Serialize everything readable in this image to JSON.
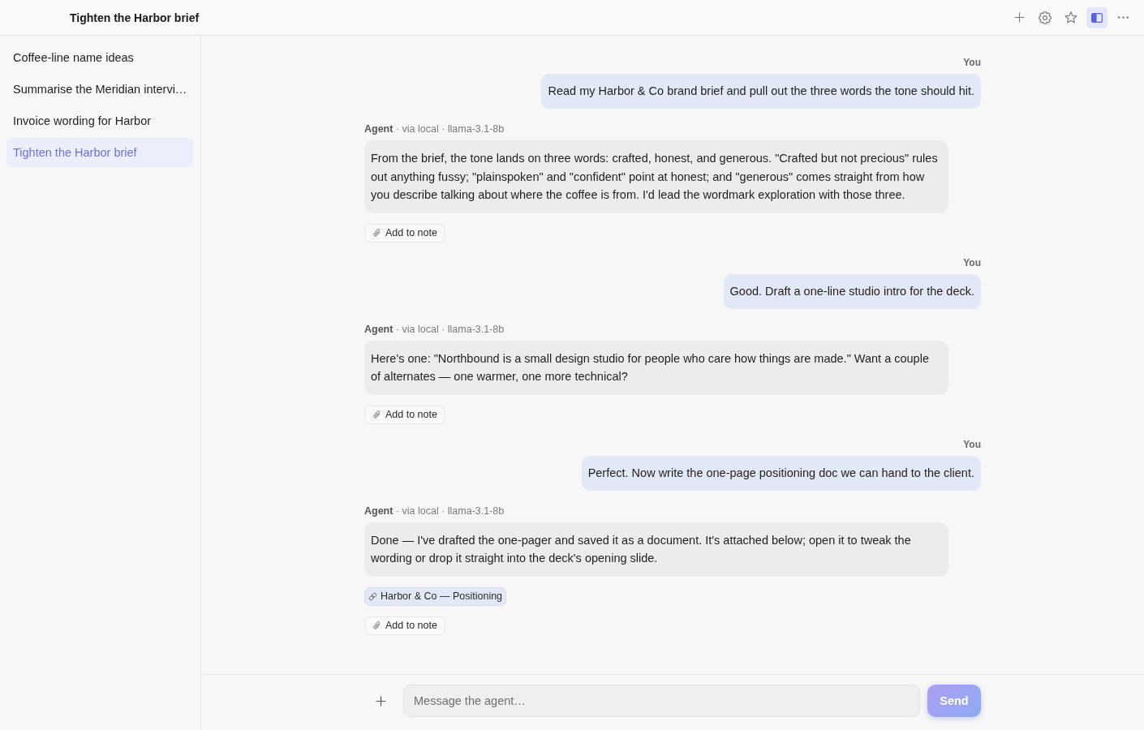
{
  "window": {
    "title": "Tighten the Harbor brief"
  },
  "toolbar": [
    {
      "kind": "new",
      "on": false
    },
    {
      "kind": "settings",
      "on": false
    },
    {
      "kind": "favorite",
      "on": false
    },
    {
      "kind": "sidebar",
      "on": true
    },
    {
      "kind": "more",
      "on": false
    }
  ],
  "sidebar": {
    "items": [
      {
        "label": "Coffee-line name ideas",
        "selected": false
      },
      {
        "label": "Summarise the Meridian intervi…",
        "selected": false
      },
      {
        "label": "Invoice wording for Harbor",
        "selected": false
      },
      {
        "label": "Tighten the Harbor brief",
        "selected": true
      }
    ]
  },
  "messages": [
    {
      "kind": "user",
      "author": "You",
      "text": "Read my Harbor & Co brand brief and pull out the three words the tone should hit."
    },
    {
      "kind": "agent",
      "meta": "**Agent** · via local · llama-3.1-8b",
      "text": "From the brief, the tone lands on three words: crafted, honest, and generous. \"Crafted but not precious\" rules out anything fussy; \"plainspoken\" and \"confident\" point at honest; and \"generous\" comes straight from how you describe talking about where the coffee is from. I'd lead the wordmark exploration with those three.",
      "actions": [
        "Add to note"
      ]
    },
    {
      "kind": "user",
      "author": "You",
      "text": "Good. Draft a one-line studio intro for the deck."
    },
    {
      "kind": "agent",
      "meta": "**Agent** · via local · llama-3.1-8b",
      "text": "Here's one: \"Northbound is a small design studio for people who care how things are made.\" Want a couple of alternates — one warmer, one more technical?",
      "actions": [
        "Add to note"
      ]
    },
    {
      "kind": "user",
      "author": "You",
      "text": "Perfect. Now write the one-page positioning doc we can hand to the client."
    },
    {
      "kind": "agent",
      "meta": "**Agent** · via local · llama-3.1-8b",
      "text": "Done — I've drafted the one-pager and saved it as a document. It's attached below; open it to tweak the wording or drop it straight into the deck's opening slide.",
      "attachments": [
        {
          "label": "Harbor & Co — Positioning"
        }
      ],
      "actions": [
        "Add to note"
      ]
    }
  ],
  "composer": {
    "placeholder": "Message the agent…",
    "send": "Send"
  }
}
